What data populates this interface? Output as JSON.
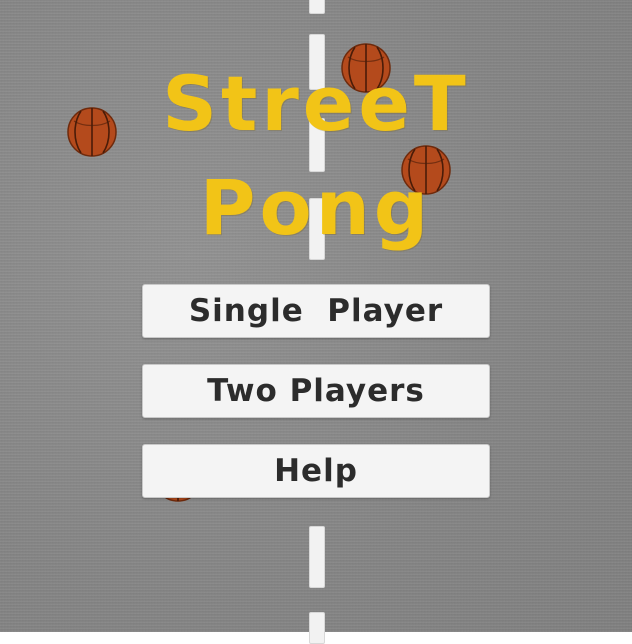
{
  "title": {
    "line1": "StreeT",
    "line2": "Pong",
    "color": "#f2c417"
  },
  "menu": {
    "single_player": "Single  Player",
    "two_players": "Two Players",
    "help": "Help"
  },
  "colors": {
    "court": "#8a8a8a",
    "center_line": "#f2f2f2",
    "ball": "#b44a1c",
    "button_background": "#f4f4f4",
    "button_text": "#2c2c2c"
  },
  "icons": [
    "basketball-icon"
  ]
}
